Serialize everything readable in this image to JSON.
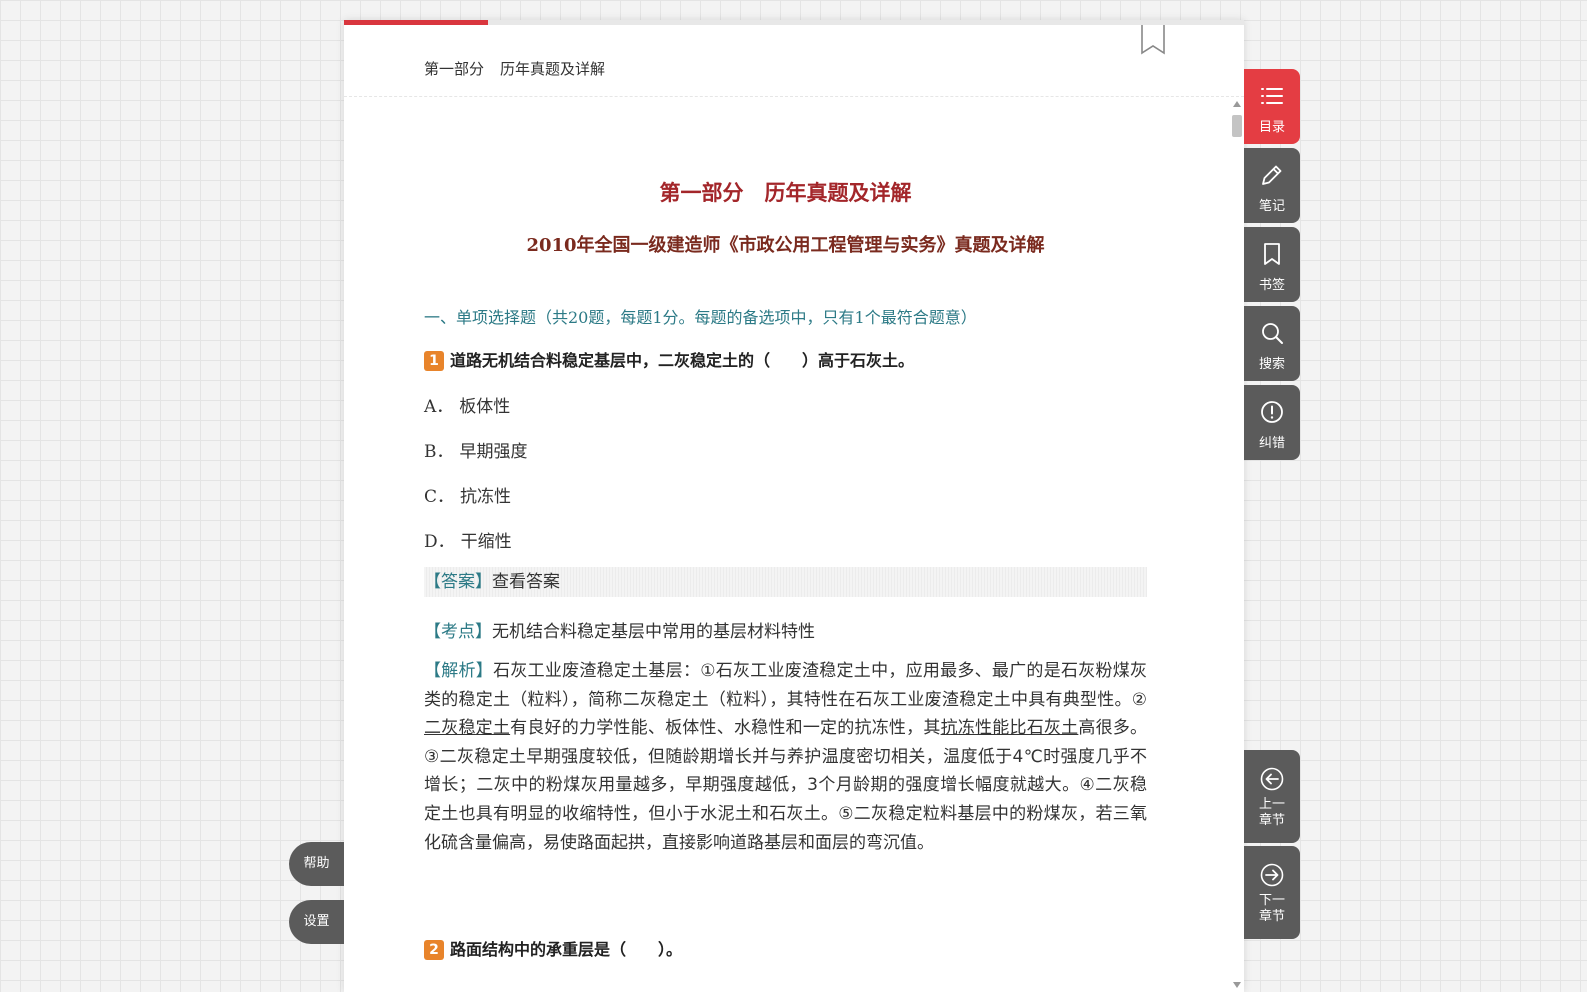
{
  "header": {
    "chapter_part": "第一部分",
    "chapter_title": "历年真题及详解",
    "reading_progress": 0.16
  },
  "content": {
    "part_title": "第一部分　历年真题及详解",
    "exam_title": "2010年全国一级建造师《市政公用工程管理与实务》真题及详解",
    "section_heading": "一、单项选择题（共20题，每题1分。每题的备选项中，只有1个最符合题意）",
    "q1": {
      "number": "1",
      "stem": "道路无机结合料稳定基层中，二灰稳定土的（　　）高于石灰土。",
      "options": [
        {
          "letter": "A．",
          "text": "板体性"
        },
        {
          "letter": "B．",
          "text": "早期强度"
        },
        {
          "letter": "C．",
          "text": "抗冻性"
        },
        {
          "letter": "D．",
          "text": "干缩性"
        }
      ],
      "answer_tag": "【答案】",
      "answer_link": "查看答案",
      "point_tag": "【考点】",
      "point_text": "无机结合料稳定基层中常用的基层材料特性",
      "analysis_tag": "【解析】",
      "analysis": {
        "p1": "石灰工业废渣稳定土基层：①石灰工业废渣稳定土中，应用最多、最广的是石灰粉煤灰类的稳定土（粒料），简称二灰稳定土（粒料），其特性在石灰工业废渣稳定土中具有典型性。②",
        "u1": "二灰稳定土",
        "p2": "有良好的力学性能、板体性、水稳性和一定的抗冻性，其",
        "u2": "抗冻性能比石灰土",
        "p3": "高很多。③二灰稳定土早期强度较低，但随龄期增长并与养护温度密切相关，温度低于4℃时强度几乎不增长；二灰中的粉煤灰用量越多，早期强度越低，3个月龄期的强度增长幅度就越大。④二灰稳定土也具有明显的收缩特性，但小于水泥土和石灰土。⑤二灰稳定粒料基层中的粉煤灰，若三氧化硫含量偏高，易使路面起拱，直接影响道路基层和面层的弯沉值。"
      }
    },
    "q2": {
      "number": "2",
      "stem": "路面结构中的承重层是（　　）。"
    }
  },
  "toolbar": {
    "toc": "目录",
    "notes": "笔记",
    "bookmark": "书签",
    "search": "搜索",
    "report": "纠错",
    "prev_chapter": "上一章节",
    "next_chapter": "下一章节"
  },
  "left_panel": {
    "help": "帮助",
    "settings": "设置"
  },
  "colors": {
    "accent_red": "#e43d43",
    "title_red": "#a3262a",
    "teal": "#2c7a86",
    "badge_orange": "#e8842b",
    "tool_gray": "#5b5b5b"
  }
}
